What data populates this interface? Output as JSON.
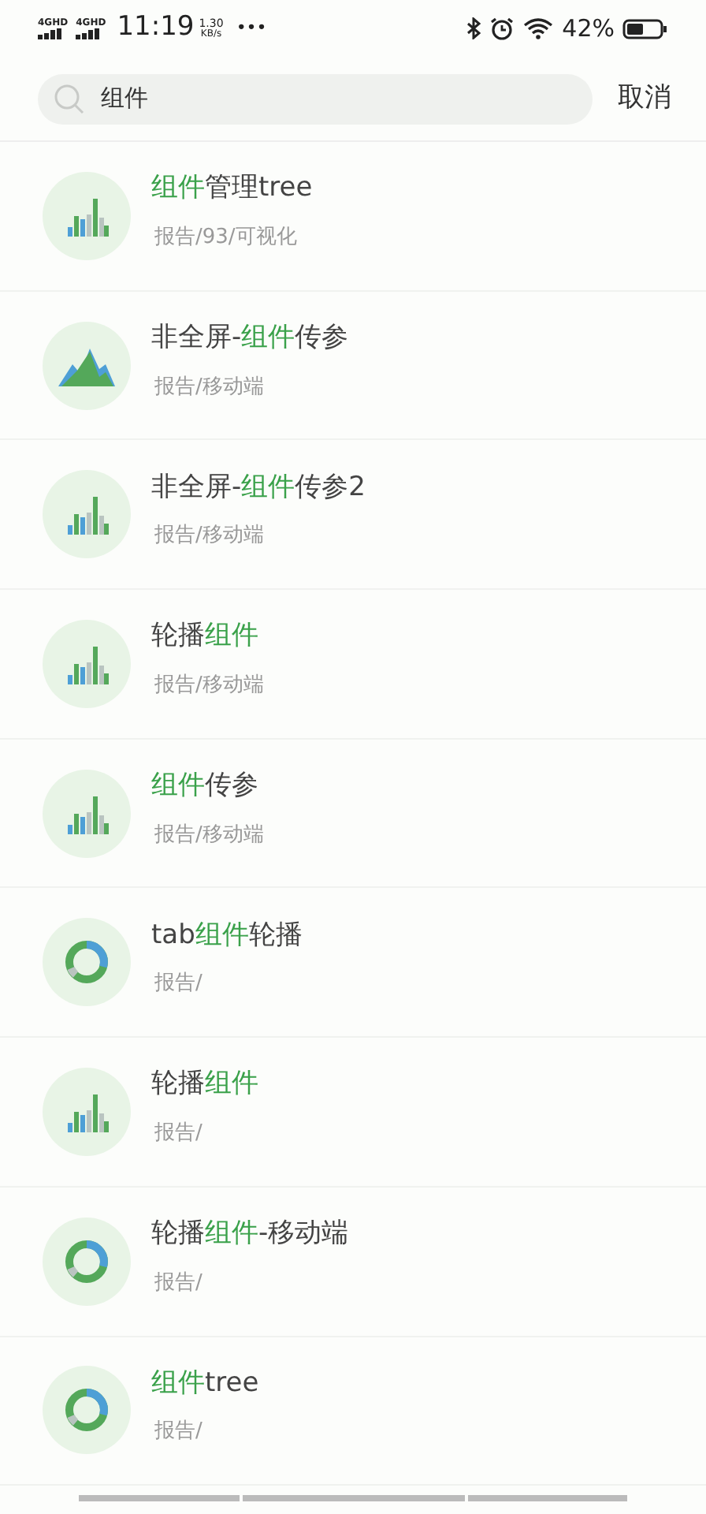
{
  "status_bar": {
    "networks": [
      "4GHD",
      "4GHD"
    ],
    "time": "11:19",
    "speed_value": "1.30",
    "speed_unit": "KB/s",
    "more": "•••",
    "battery": "42%"
  },
  "search": {
    "value": "组件",
    "cancel": "取消"
  },
  "results": [
    {
      "kind": "bars",
      "title": [
        {
          "text": "组件",
          "highlight": true
        },
        {
          "text": "管理tree",
          "highlight": false
        }
      ],
      "path": "报告/93/可视化"
    },
    {
      "kind": "mountain",
      "title": [
        {
          "text": "非全屏-",
          "highlight": false
        },
        {
          "text": "组件",
          "highlight": true
        },
        {
          "text": "传参",
          "highlight": false
        }
      ],
      "path": "报告/移动端"
    },
    {
      "kind": "bars",
      "title": [
        {
          "text": "非全屏-",
          "highlight": false
        },
        {
          "text": "组件",
          "highlight": true
        },
        {
          "text": "传参2",
          "highlight": false
        }
      ],
      "path": "报告/移动端"
    },
    {
      "kind": "bars",
      "title": [
        {
          "text": "轮播",
          "highlight": false
        },
        {
          "text": "组件",
          "highlight": true
        }
      ],
      "path": "报告/移动端"
    },
    {
      "kind": "bars",
      "title": [
        {
          "text": "组件",
          "highlight": true
        },
        {
          "text": "传参",
          "highlight": false
        }
      ],
      "path": "报告/移动端"
    },
    {
      "kind": "donut",
      "title": [
        {
          "text": "tab",
          "highlight": false
        },
        {
          "text": "组件",
          "highlight": true
        },
        {
          "text": "轮播",
          "highlight": false
        }
      ],
      "path": "报告/"
    },
    {
      "kind": "bars",
      "title": [
        {
          "text": "轮播",
          "highlight": false
        },
        {
          "text": "组件",
          "highlight": true
        }
      ],
      "path": "报告/"
    },
    {
      "kind": "donut",
      "title": [
        {
          "text": "轮播",
          "highlight": false
        },
        {
          "text": "组件",
          "highlight": true
        },
        {
          "text": "-移动端",
          "highlight": false
        }
      ],
      "path": "报告/"
    },
    {
      "kind": "donut",
      "title": [
        {
          "text": "组件",
          "highlight": true
        },
        {
          "text": "tree",
          "highlight": false
        }
      ],
      "path": "报告/"
    }
  ]
}
